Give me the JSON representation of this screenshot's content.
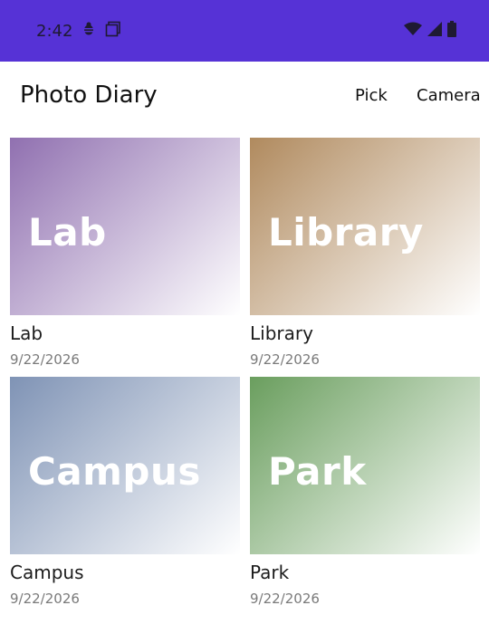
{
  "status_bar": {
    "time": "2:42",
    "icons": [
      "bug-icon",
      "screenshot-icon",
      "wifi-icon",
      "signal-icon",
      "battery-icon"
    ],
    "background": "#5632d6"
  },
  "app_bar": {
    "title": "Photo Diary",
    "actions": [
      {
        "label": "Pick"
      },
      {
        "label": "Camera"
      }
    ]
  },
  "entries": [
    {
      "thumb_label": "Lab",
      "title": "Lab",
      "date": "9/22/2026",
      "color": "#9070b0"
    },
    {
      "thumb_label": "Library",
      "title": "Library",
      "date": "9/22/2026",
      "color": "#b08a5e"
    },
    {
      "thumb_label": "Campus",
      "title": "Campus",
      "date": "9/22/2026",
      "color": "#7f93b5"
    },
    {
      "thumb_label": "Park",
      "title": "Park",
      "date": "9/22/2026",
      "color": "#6a9e5e"
    }
  ]
}
